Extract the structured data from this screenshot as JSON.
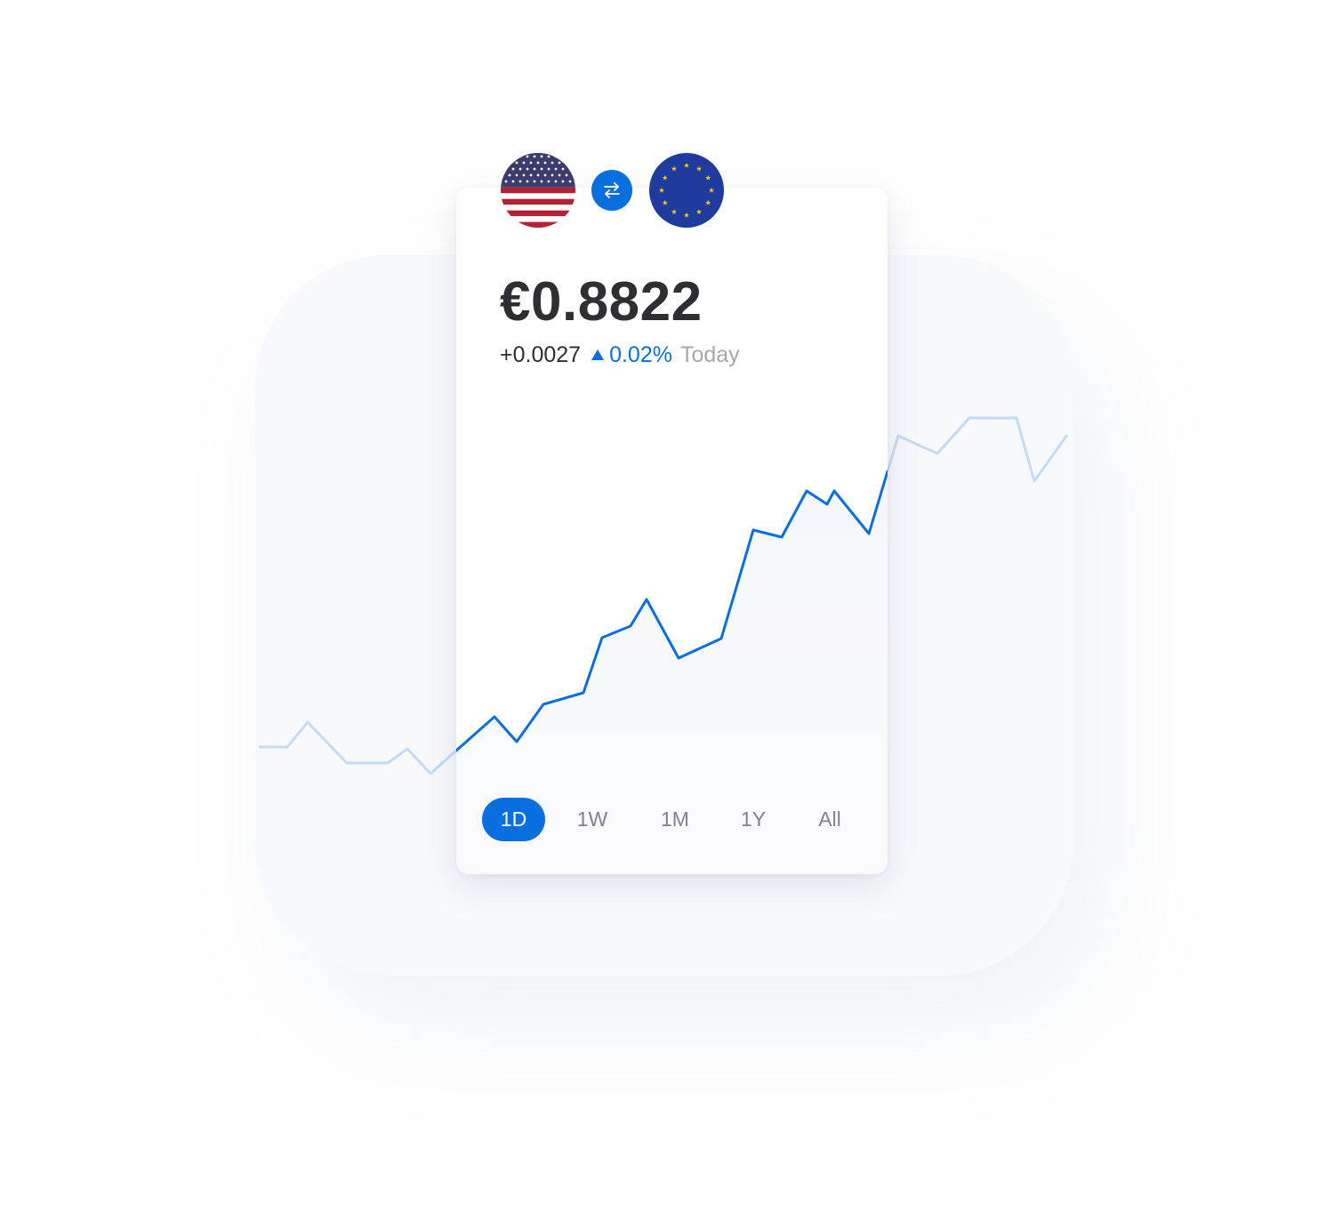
{
  "pair": {
    "base_flag": "us-flag-icon",
    "quote_flag": "eu-flag-icon",
    "swap_icon": "swap-arrows-icon"
  },
  "quote": {
    "rate": "€0.8822",
    "change_abs": "+0.0027",
    "change_pct": "0.02%",
    "period": "Today",
    "direction_icon": "triangle-up-icon"
  },
  "ranges": [
    {
      "label": "1D",
      "active": true
    },
    {
      "label": "1W",
      "active": false
    },
    {
      "label": "1M",
      "active": false
    },
    {
      "label": "1Y",
      "active": false
    },
    {
      "label": "All",
      "active": false
    }
  ],
  "colors": {
    "accent": "#0a6fde",
    "line_faded": "#c4dbf5",
    "text_dark": "#2e2e33",
    "text_muted": "#a3a8b2",
    "us_red": "#b22234",
    "us_blue": "#3c3b6e",
    "eu_blue": "#1f3ba0",
    "eu_star": "#ffcc00"
  }
}
